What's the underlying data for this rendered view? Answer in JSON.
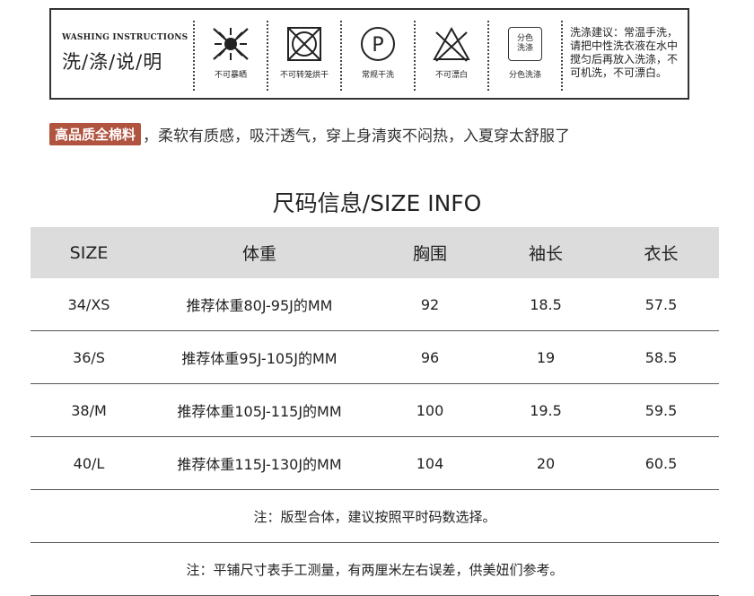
{
  "wash": {
    "title_en": "WASHING INSTRUCTIONS",
    "title_zh": "洗/涤/说/明",
    "icons": [
      {
        "icon": "no-sun-icon",
        "caption": "不可暴晒"
      },
      {
        "icon": "no-tumble-dry-icon",
        "caption": "不可转笼烘干"
      },
      {
        "icon": "dry-clean-p-icon",
        "symbol": "P",
        "caption": "常规干洗"
      },
      {
        "icon": "no-bleach-icon",
        "caption": "不可漂白"
      },
      {
        "icon": "wash-separately-icon",
        "symbol": "分色\n洗涤",
        "symbol_line1": "分色",
        "symbol_line2": "洗涤",
        "caption": "分色洗涤"
      }
    ],
    "advice": "洗涤建议：常温手洗，请把中性洗衣液在水中搅匀后再放入洗涤，不可机洗，不可漂白。"
  },
  "tagline": {
    "badge": "高品质全棉料",
    "text": "，柔软有质感，吸汗透气，穿上身清爽不闷热，入夏穿太舒服了"
  },
  "size": {
    "title": "尺码信息/SIZE INFO",
    "headers": [
      "SIZE",
      "体重",
      "胸围",
      "袖长",
      "衣长"
    ],
    "rows": [
      [
        "34/XS",
        "推荐体重80J-95J的MM",
        "92",
        "18.5",
        "57.5"
      ],
      [
        "36/S",
        "推荐体重95J-105J的MM",
        "96",
        "19",
        "58.5"
      ],
      [
        "38/M",
        "推荐体重105J-115J的MM",
        "100",
        "19.5",
        "59.5"
      ],
      [
        "40/L",
        "推荐体重115J-130J的MM",
        "104",
        "20",
        "60.5"
      ]
    ],
    "notes": [
      "注：版型合体，建议按照平时码数选择。",
      "注：平铺尺寸表手工测量，有两厘米左右误差，供美妞们参考。"
    ]
  },
  "colors": {
    "badge_bg": "#b0533f",
    "header_bg": "#dcdcdc",
    "text": "#222222"
  }
}
